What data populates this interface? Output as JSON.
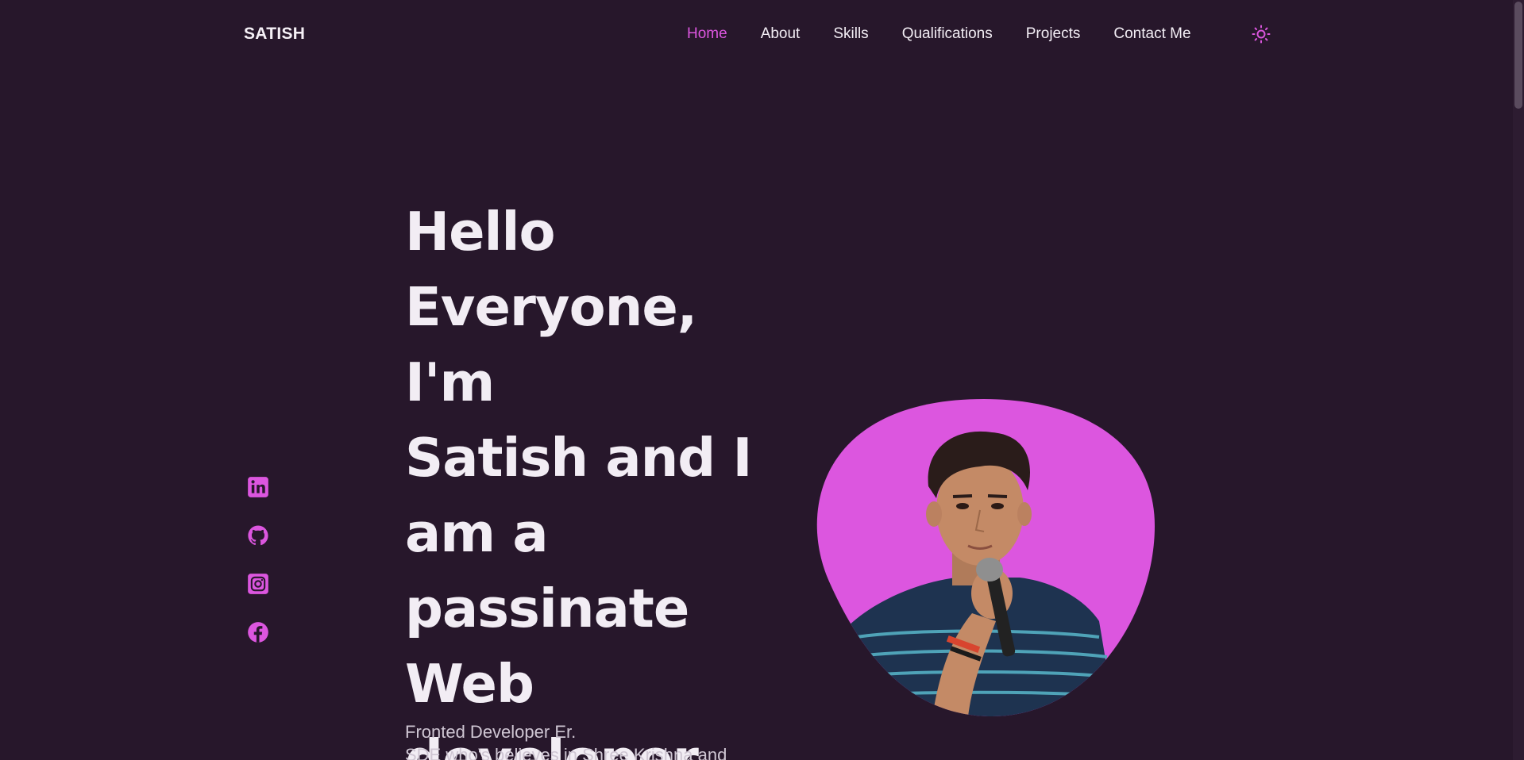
{
  "header": {
    "logo": "SATISH",
    "nav": [
      {
        "label": "Home",
        "active": true
      },
      {
        "label": "About",
        "active": false
      },
      {
        "label": "Skills",
        "active": false
      },
      {
        "label": "Qualifications",
        "active": false
      },
      {
        "label": "Projects",
        "active": false
      },
      {
        "label": "Contact Me",
        "active": false
      }
    ],
    "theme_icon": "sun-icon"
  },
  "hero": {
    "title_lines": [
      "Hello",
      "Everyone, I'm",
      "Satish and I",
      "am a",
      "passinate",
      "Web",
      "developer"
    ],
    "description_lines": [
      "Fronted Developer Er.",
      "SDE who's believes in Shree Krishna and"
    ]
  },
  "social": [
    {
      "icon": "linkedin-icon"
    },
    {
      "icon": "github-icon"
    },
    {
      "icon": "instagram-icon"
    },
    {
      "icon": "facebook-icon"
    }
  ],
  "colors": {
    "background": "#27172b",
    "accent": "#dc56df",
    "text": "#f2edf4"
  }
}
